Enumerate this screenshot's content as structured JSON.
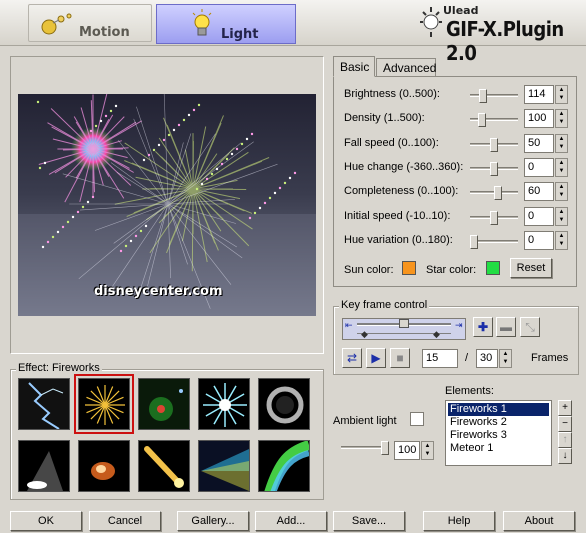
{
  "header": {
    "tabs": [
      {
        "label": "Motion",
        "icon": "motion-icon",
        "active": false
      },
      {
        "label": "Light",
        "icon": "lightbulb-icon",
        "active": true
      }
    ],
    "brand_small": "Ulead",
    "brand_big": "GIF-X.Plugin 2.0"
  },
  "preview": {
    "watermark": "disneycenter.com"
  },
  "settings": {
    "tabs": [
      "Basic",
      "Advanced"
    ],
    "active_tab": "Basic",
    "params": [
      {
        "label": "Brightness (0..500):",
        "value": "114",
        "level": 0.23
      },
      {
        "label": "Density (1..500):",
        "value": "100",
        "level": 0.2
      },
      {
        "label": "Fall speed (0..100):",
        "value": "50",
        "level": 0.5
      },
      {
        "label": "Hue change (-360..360):",
        "value": "0",
        "level": 0.5
      },
      {
        "label": "Completeness (0..100):",
        "value": "60",
        "level": 0.6
      },
      {
        "label": "Initial speed (-10..10):",
        "value": "0",
        "level": 0.5
      },
      {
        "label": "Hue variation (0..180):",
        "value": "0",
        "level": 0.0
      }
    ],
    "sun_color_label": "Sun color:",
    "sun_color": "#f7941d",
    "star_color_label": "Star color:",
    "star_color": "#22dd44",
    "reset_label": "Reset"
  },
  "keyframe": {
    "title": "Key frame control",
    "current_frame": "15",
    "separator": "/",
    "total_frames": "30",
    "frames_label": "Frames"
  },
  "effect": {
    "label": "Effect: Fireworks",
    "thumbnails": [
      "Lightning",
      "Fireworks",
      "Sparkle Orb",
      "Starburst",
      "Halo Ring",
      "Spotlight",
      "Glow",
      "Comet",
      "Light Beam",
      "Rainbow Flare"
    ],
    "selected_index": 1
  },
  "elements": {
    "label": "Elements:",
    "items": [
      "Fireworks 1",
      "Fireworks 2",
      "Fireworks 3",
      "Meteor 1"
    ],
    "selected_index": 0
  },
  "ambient": {
    "label": "Ambient light",
    "value": "100",
    "level": 1.0
  },
  "buttons": {
    "ok": "OK",
    "cancel": "Cancel",
    "gallery": "Gallery...",
    "add": "Add...",
    "save": "Save...",
    "help": "Help",
    "about": "About"
  },
  "colors": {
    "accent": "#9c9ef0",
    "selection": "#0a246a",
    "preview_bg": "#2f3142"
  }
}
